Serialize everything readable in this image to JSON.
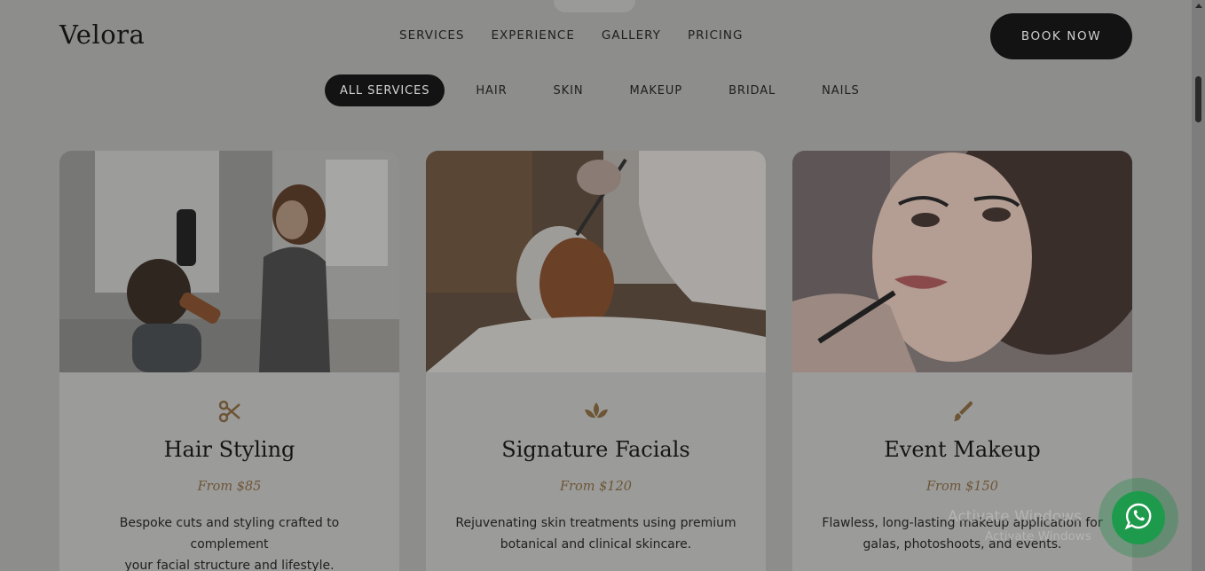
{
  "brand": {
    "logo": "Velora"
  },
  "nav": {
    "items": [
      "SERVICES",
      "EXPERIENCE",
      "GALLERY",
      "PRICING"
    ],
    "book_label": "BOOK NOW"
  },
  "filters": {
    "items": [
      "ALL SERVICES",
      "HAIR",
      "SKIN",
      "MAKEUP",
      "BRIDAL",
      "NAILS"
    ],
    "active": "ALL SERVICES"
  },
  "cards": [
    {
      "icon": "scissors-icon",
      "photo": "hairstylist blow-drying client photo",
      "title": "Hair Styling",
      "price": "From $85",
      "desc_line1": "Bespoke cuts and styling crafted to complement",
      "desc_line2": "your facial structure and lifestyle."
    },
    {
      "icon": "lotus-icon",
      "photo": "facial mask application photo",
      "title": "Signature Facials",
      "price": "From $120",
      "desc_line1": "Rejuvenating skin treatments using premium",
      "desc_line2": "botanical and clinical skincare."
    },
    {
      "icon": "brush-icon",
      "photo": "lipstick makeup application photo",
      "title": "Event Makeup",
      "price": "From $150",
      "desc_line1": "Flawless, long-lasting makeup application for",
      "desc_line2": "galas, photoshoots, and events."
    }
  ],
  "whatsapp": {
    "icon": "whatsapp-icon"
  },
  "watermark": {
    "line1": "Activate Windows",
    "line2": "Activate Windows"
  },
  "colors": {
    "overlay": "#8d8d8c",
    "dark": "#131313",
    "accent": "#6d5536",
    "whatsapp": "#1e9a4c"
  }
}
